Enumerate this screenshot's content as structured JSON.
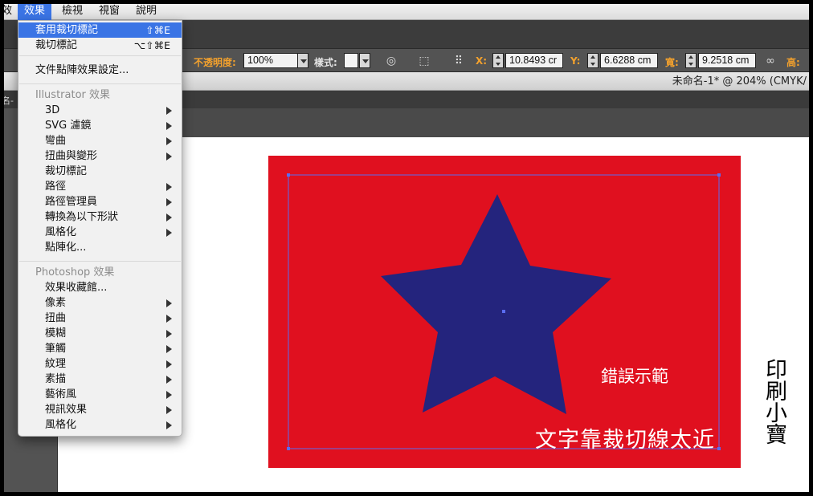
{
  "menubar": {
    "items": [
      "效",
      "效果",
      "檢視",
      "視窗",
      "說明"
    ],
    "active_index": 1
  },
  "toolbar": {
    "opacity_label": "不透明度:",
    "opacity_value": "100%",
    "style_label": "樣式:",
    "x_label": "X:",
    "x_value": "10.8493 cr",
    "y_label": "Y:",
    "y_value": "6.6288 cm",
    "width_label": "寬:",
    "width_value": "9.2518 cm",
    "height_label": "高:"
  },
  "document": {
    "title": "未命名-1* @ 204% (CMYK/",
    "panel_name": "名-"
  },
  "effect_menu": {
    "apply_item": {
      "label": "套用裁切標記",
      "shortcut": "⇧⌘E"
    },
    "crop_item": {
      "label": "裁切標記",
      "shortcut": "⌥⇧⌘E"
    },
    "raster_settings": "文件點陣效果設定...",
    "illustrator_header": "Illustrator 效果",
    "illustrator_items": [
      {
        "label": "3D",
        "submenu": true
      },
      {
        "label": "SVG 濾鏡",
        "submenu": true
      },
      {
        "label": "彎曲",
        "submenu": true
      },
      {
        "label": "扭曲與變形",
        "submenu": true
      },
      {
        "label": "裁切標記",
        "submenu": false
      },
      {
        "label": "路徑",
        "submenu": true
      },
      {
        "label": "路徑管理員",
        "submenu": true
      },
      {
        "label": "轉換為以下形狀",
        "submenu": true
      },
      {
        "label": "風格化",
        "submenu": true
      },
      {
        "label": "點陣化...",
        "submenu": false
      }
    ],
    "photoshop_header": "Photoshop 效果",
    "photoshop_items": [
      {
        "label": "效果收藏館...",
        "submenu": false
      },
      {
        "label": "像素",
        "submenu": true
      },
      {
        "label": "扭曲",
        "submenu": true
      },
      {
        "label": "模糊",
        "submenu": true
      },
      {
        "label": "筆觸",
        "submenu": true
      },
      {
        "label": "紋理",
        "submenu": true
      },
      {
        "label": "素描",
        "submenu": true
      },
      {
        "label": "藝術風",
        "submenu": true
      },
      {
        "label": "視訊效果",
        "submenu": true
      },
      {
        "label": "風格化",
        "submenu": true
      }
    ]
  },
  "artwork": {
    "label_wrong_example": "錯誤示範",
    "label_text_close": "文字靠裁切線太近",
    "side_caption": "印刷小寶",
    "colors": {
      "background": "#e0101f",
      "star": "#24247d",
      "selection": "#5a6cf0"
    }
  }
}
